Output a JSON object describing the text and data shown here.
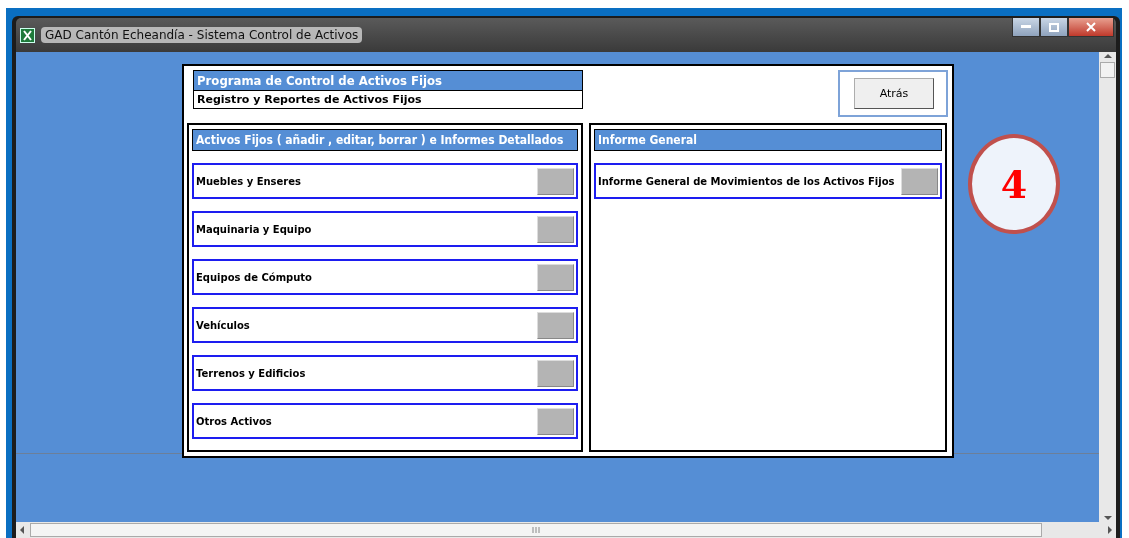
{
  "window": {
    "title": "GAD Cantón Echeandía - Sistema Control de Activos"
  },
  "header": {
    "title": "Programa de Control de Activos Fijos",
    "subtitle": "Registro y Reportes de Activos Fijos"
  },
  "back_button": {
    "label": "Atrás"
  },
  "sections": [
    {
      "title": "Activos Fijos ( añadir , editar, borrar ) e Informes Detallados",
      "items": [
        {
          "label": "Muebles y Enseres"
        },
        {
          "label": "Maquinaria y Equipo"
        },
        {
          "label": "Equipos de Cómputo"
        },
        {
          "label": "Vehículos"
        },
        {
          "label": "Terrenos y Edificios"
        },
        {
          "label": "Otros Activos"
        }
      ]
    },
    {
      "title": "Informe General",
      "items": [
        {
          "label": "Informe General de Movimientos de los Activos Fijos"
        }
      ]
    }
  ],
  "annotation": {
    "label": "4"
  }
}
